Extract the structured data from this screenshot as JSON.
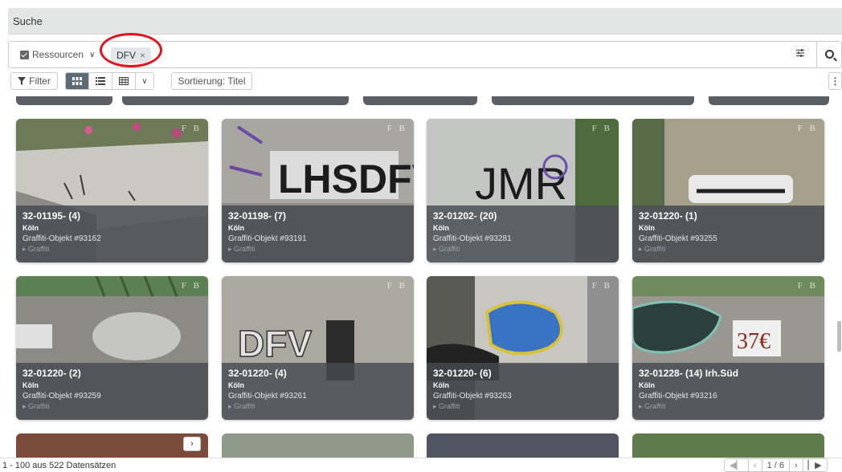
{
  "window": {
    "title": "Suche"
  },
  "search": {
    "resource_label": "Ressourcen",
    "chip_label": "DFV",
    "chip_close": "×"
  },
  "toolbar": {
    "filter_label": "Filter",
    "sort_label": "Sortierung: Titel"
  },
  "cards": [
    {
      "title": "32-01195- (4)",
      "city": "Köln",
      "object": "Graffiti-Objekt #93162",
      "category": "Graffiti"
    },
    {
      "title": "32-01198- (7)",
      "city": "Köln",
      "object": "Graffiti-Objekt #93191",
      "category": "Graffiti"
    },
    {
      "title": "32-01202- (20)",
      "city": "Köln",
      "object": "Graffiti-Objekt #93281",
      "category": "Graffiti"
    },
    {
      "title": "32-01220- (1)",
      "city": "Köln",
      "object": "Graffiti-Objekt #93255",
      "category": "Graffiti"
    },
    {
      "title": "32-01220- (2)",
      "city": "Köln",
      "object": "Graffiti-Objekt #93259",
      "category": "Graffiti"
    },
    {
      "title": "32-01220- (4)",
      "city": "Köln",
      "object": "Graffiti-Objekt #93261",
      "category": "Graffiti"
    },
    {
      "title": "32-01220- (6)",
      "city": "Köln",
      "object": "Graffiti-Objekt #93263",
      "category": "Graffiti"
    },
    {
      "title": "32-01228- (14) Irh.Süd",
      "city": "Köln",
      "object": "Graffiti-Objekt #93216",
      "category": "Graffiti"
    }
  ],
  "card_badge": "F B",
  "footer": {
    "record_count": "1 - 100 aus 522 Datensätzen",
    "page_indicator": "1 / 6"
  },
  "colors": {
    "accent_active": "#5c6b76",
    "highlight_circle": "#e3131b",
    "card_overlay": "#464b50"
  }
}
